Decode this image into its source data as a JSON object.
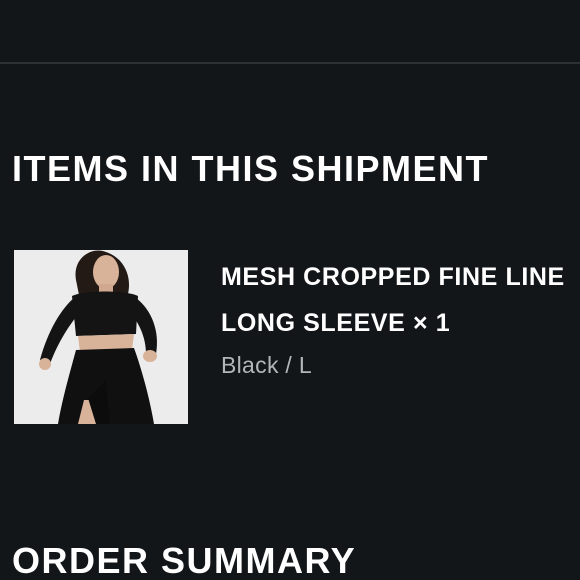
{
  "shipment": {
    "title": "ITEMS IN THIS SHIPMENT"
  },
  "items": [
    {
      "name": "MESH CROPPED FINE LINE LONG SLEEVE",
      "quantity_text": "× 1",
      "variant": "Black / L",
      "image_icon": "product-photo-model-black-crop-top-skirt"
    }
  ],
  "summary": {
    "title": "ORDER SUMMARY"
  },
  "colors": {
    "background": "#121619",
    "divider": "#2c3135",
    "text_primary": "#ffffff",
    "text_secondary": "#b3b6b8",
    "thumbnail_bg": "#ececec"
  }
}
